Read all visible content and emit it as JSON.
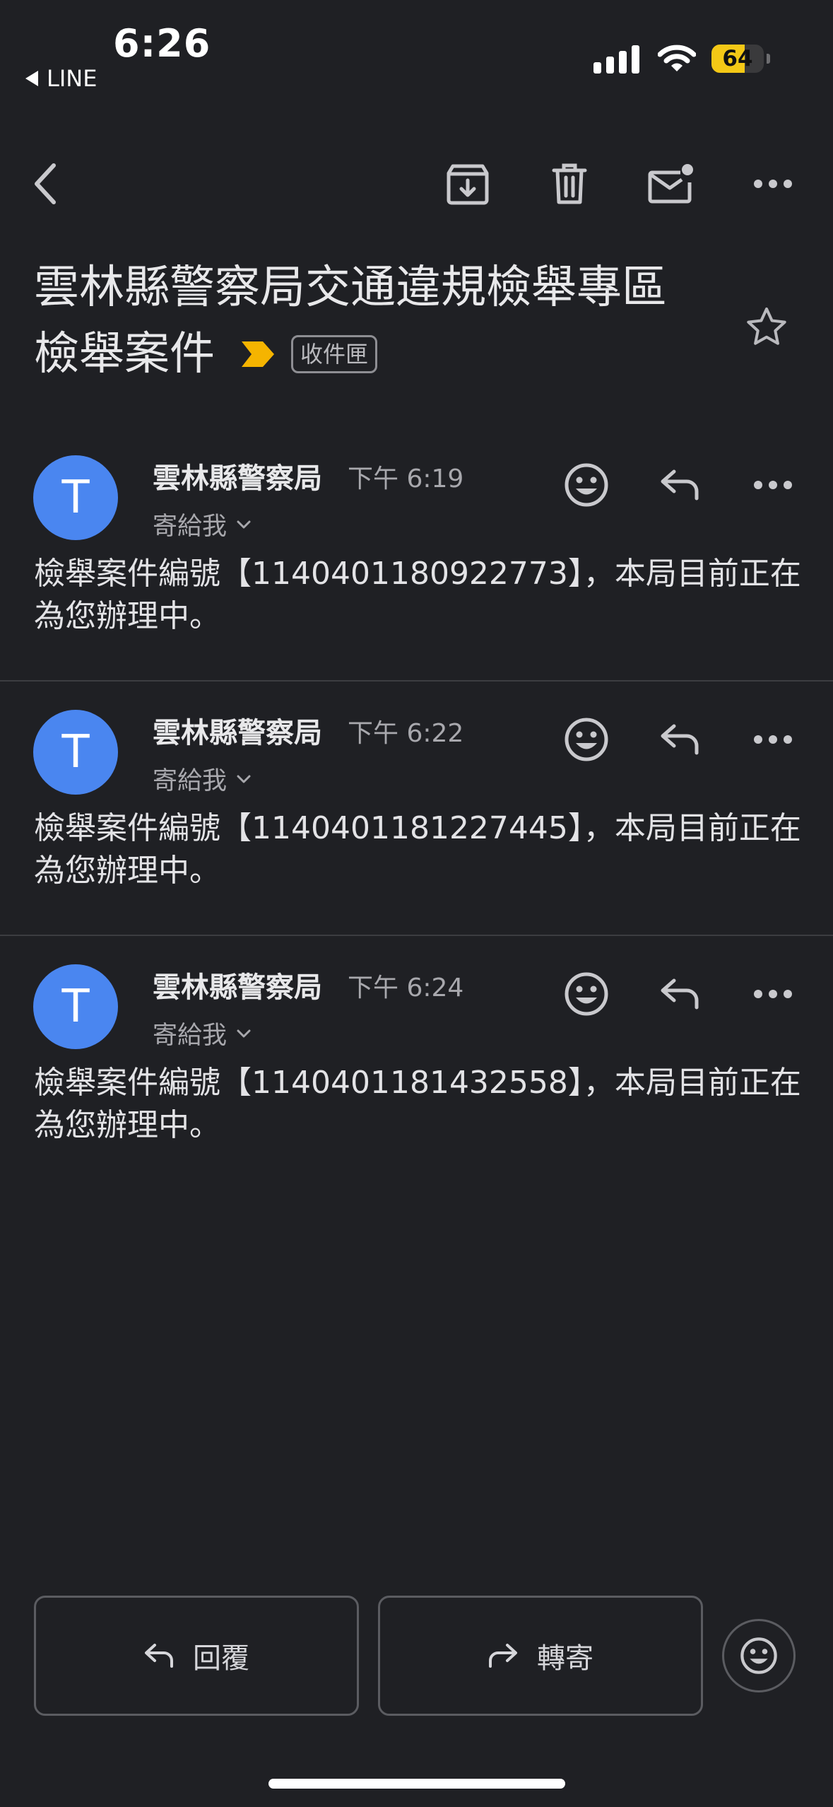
{
  "status_bar": {
    "time": "6:26",
    "back_app": "LINE",
    "battery_percent": 64,
    "battery_label": "64"
  },
  "thread": {
    "subject_line1": "雲林縣警察局交通違規檢舉專區",
    "subject_line2": "檢舉案件",
    "label": "收件匣"
  },
  "messages": [
    {
      "avatar_letter": "T",
      "sender": "雲林縣警察局",
      "time": "下午 6:19",
      "recipient": "寄給我",
      "body": "檢舉案件編號【1140401180922773】，本局目前正在為您辦理中。"
    },
    {
      "avatar_letter": "T",
      "sender": "雲林縣警察局",
      "time": "下午 6:22",
      "recipient": "寄給我",
      "body": "檢舉案件編號【1140401181227445】，本局目前正在為您辦理中。"
    },
    {
      "avatar_letter": "T",
      "sender": "雲林縣警察局",
      "time": "下午 6:24",
      "recipient": "寄給我",
      "body": "檢舉案件編號【1140401181432558】，本局目前正在為您辦理中。"
    }
  ],
  "actions": {
    "reply_label": "回覆",
    "forward_label": "轉寄"
  },
  "colors": {
    "background": "#1f2024",
    "avatar": "#4a86f0",
    "importance": "#f5b400",
    "battery": "#f4c816"
  },
  "icons": {
    "toolbar": [
      "back-arrow-icon",
      "archive-icon",
      "trash-icon",
      "mark-unread-icon",
      "more-icon"
    ],
    "message": [
      "emoji-reaction-icon",
      "reply-icon",
      "more-icon"
    ]
  }
}
